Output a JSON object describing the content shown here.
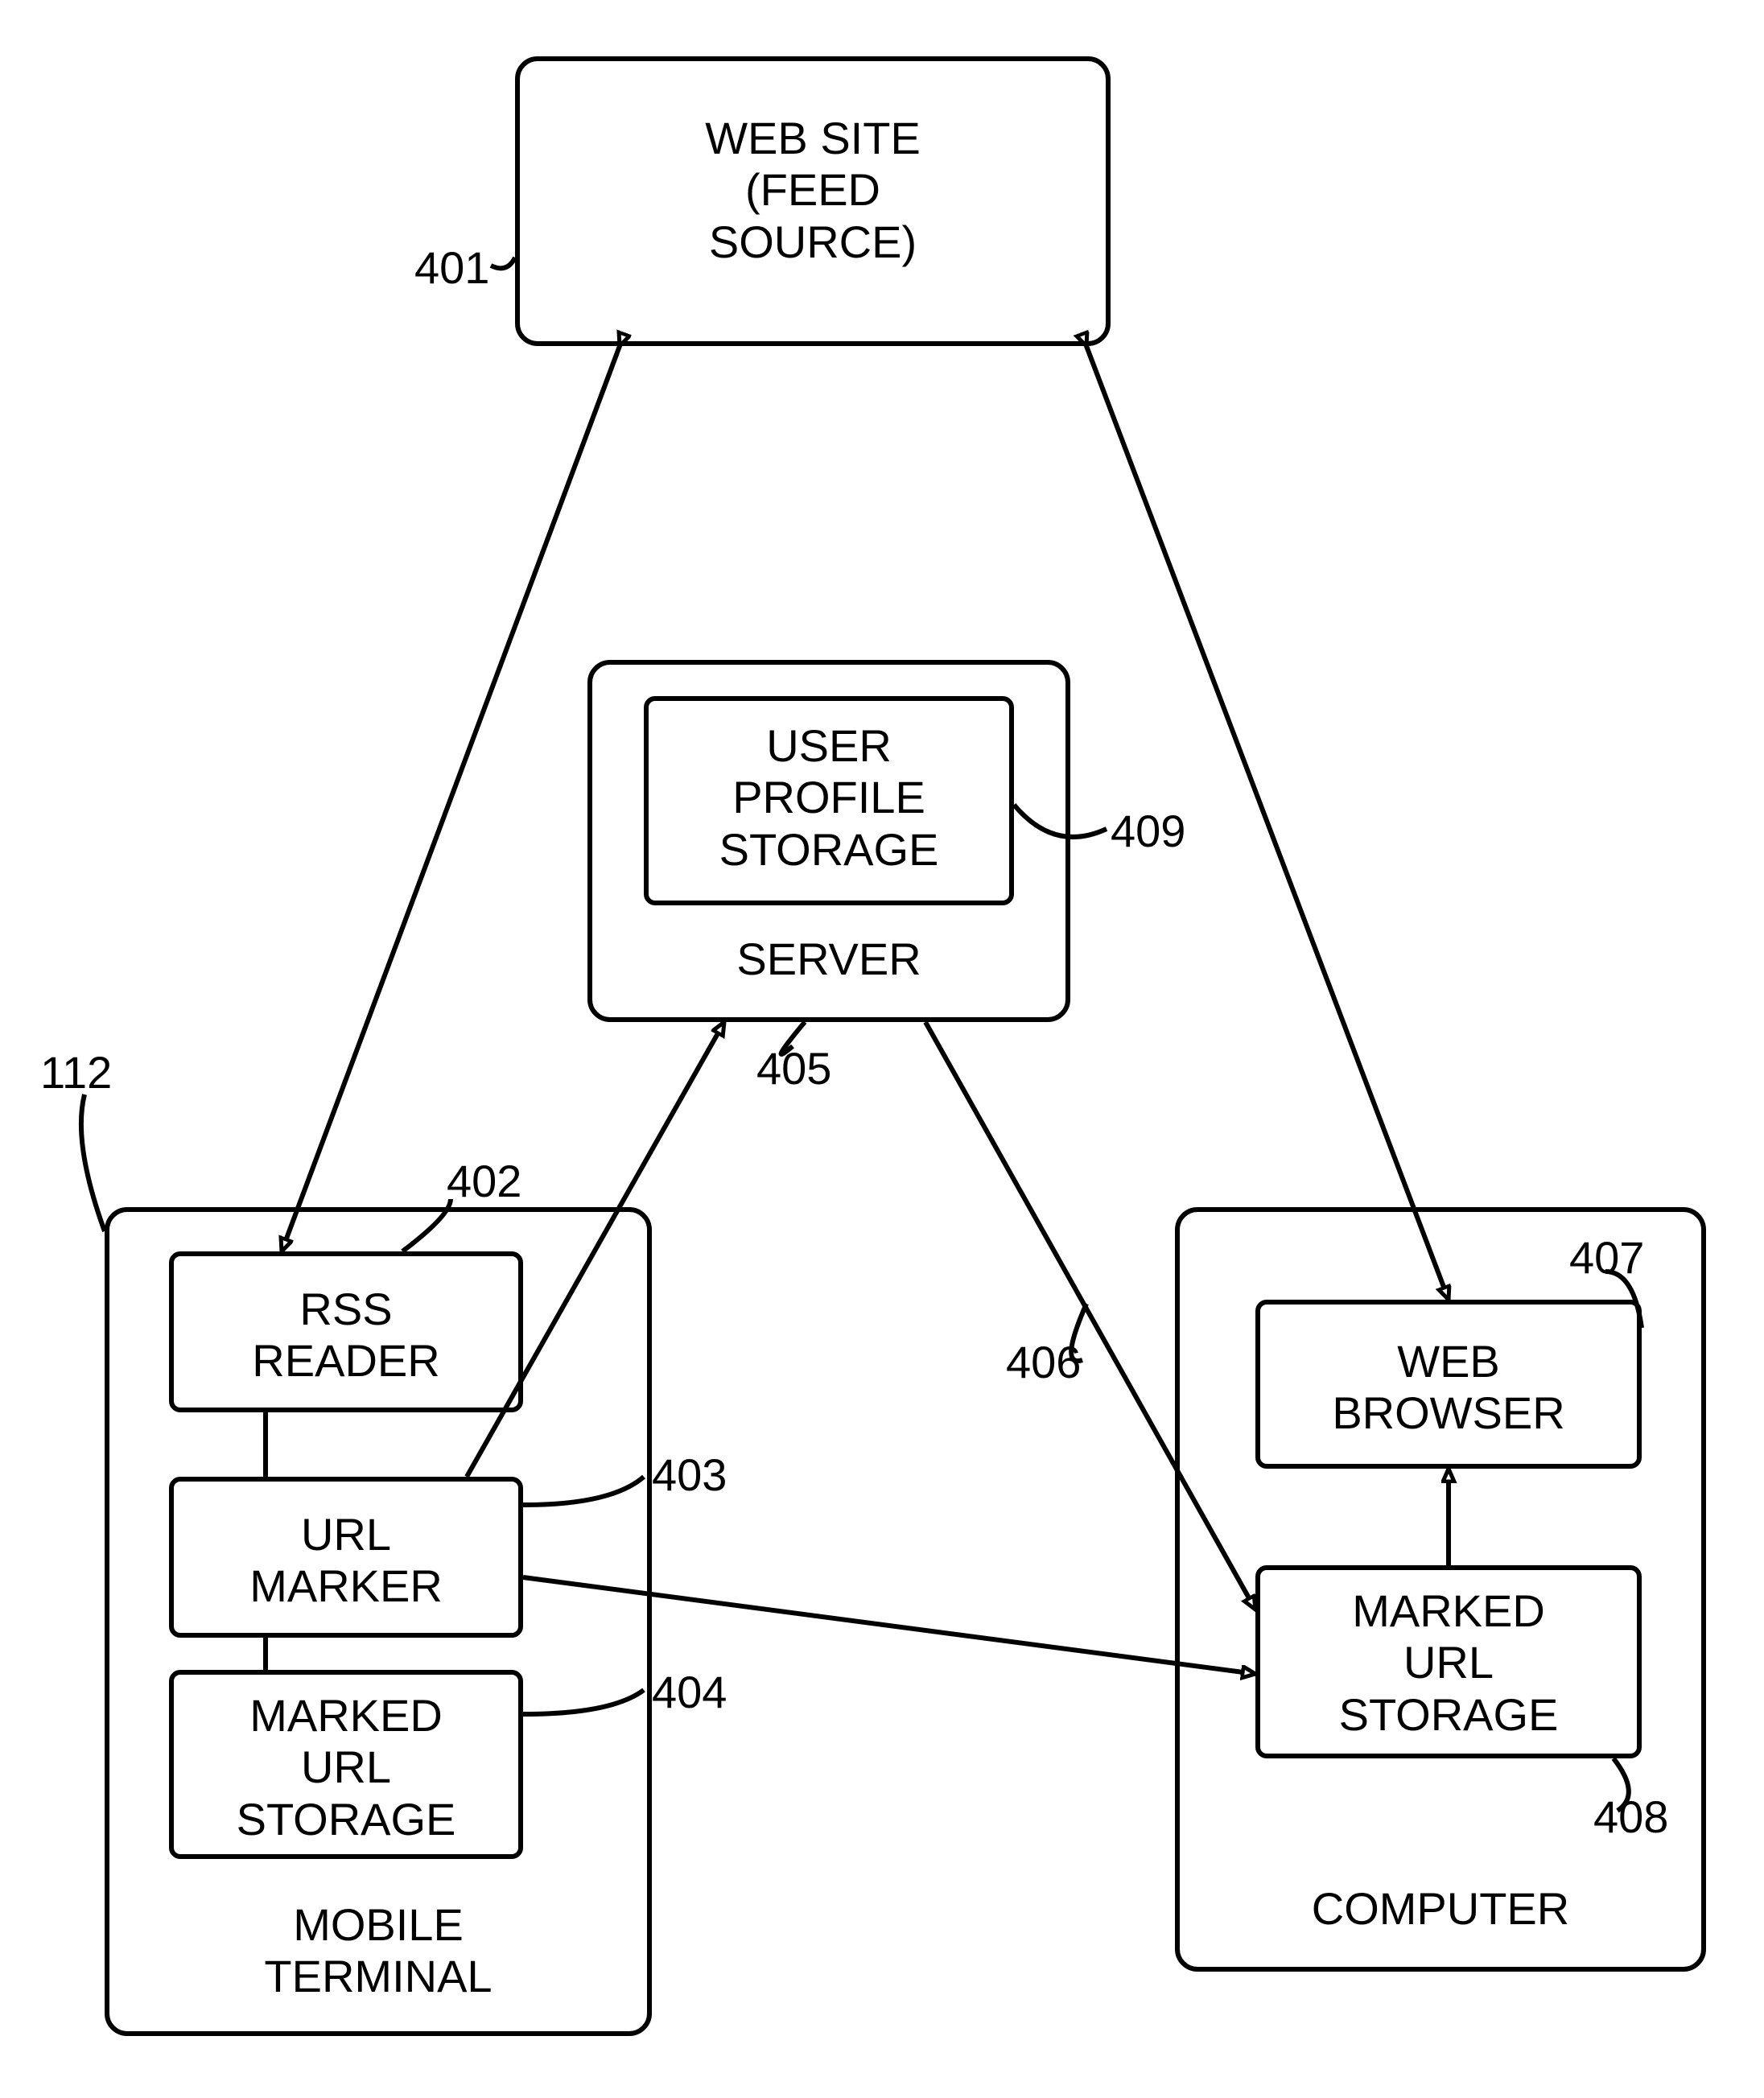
{
  "boxes": {
    "website": {
      "text": "WEB SITE\n(FEED\nSOURCE)"
    },
    "server": {
      "text": "SERVER"
    },
    "profile": {
      "text": "USER\nPROFILE\nSTORAGE"
    },
    "mobile": {
      "text": "MOBILE\nTERMINAL"
    },
    "rss": {
      "text": "RSS\nREADER"
    },
    "urlmarker": {
      "text": "URL\nMARKER"
    },
    "mstorage": {
      "text": "MARKED\nURL\nSTORAGE"
    },
    "computer": {
      "text": "COMPUTER"
    },
    "browser": {
      "text": "WEB\nBROWSER"
    },
    "cstorage": {
      "text": "MARKED\nURL\nSTORAGE"
    }
  },
  "refs": {
    "r401": "401",
    "r402": "402",
    "r403": "403",
    "r404": "404",
    "r405": "405",
    "r406": "406",
    "r407": "407",
    "r408": "408",
    "r409": "409",
    "r112": "112"
  }
}
